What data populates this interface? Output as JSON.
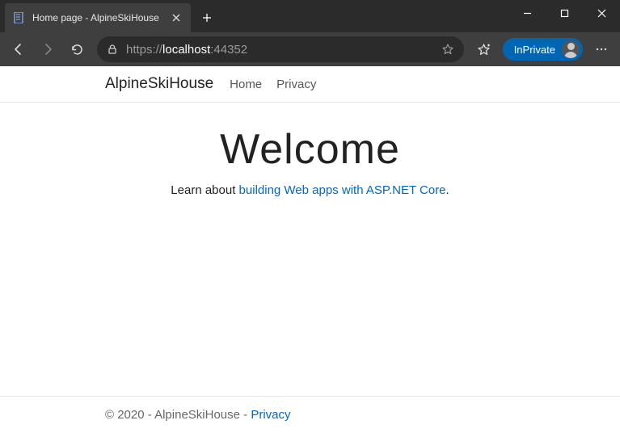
{
  "browser": {
    "tab": {
      "title": "Home page - AlpineSkiHouse"
    },
    "inprivate_label": "InPrivate",
    "url": {
      "scheme": "https://",
      "host": "localhost",
      "port": ":44352"
    }
  },
  "nav": {
    "brand": "AlpineSkiHouse",
    "links": {
      "home": "Home",
      "privacy": "Privacy"
    }
  },
  "hero": {
    "heading": "Welcome",
    "lead_prefix": "Learn about ",
    "lead_link": "building Web apps with ASP.NET Core",
    "lead_suffix": "."
  },
  "footer": {
    "text": "© 2020 - AlpineSkiHouse - ",
    "privacy": "Privacy"
  }
}
